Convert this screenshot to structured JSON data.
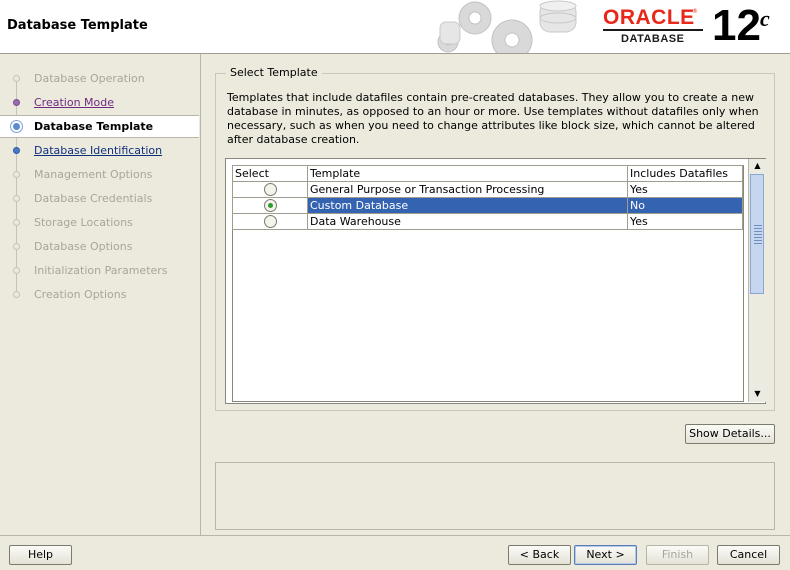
{
  "header": {
    "title": "Database Template",
    "logo_brand": "ORACLE",
    "logo_reg": "®",
    "logo_product": "DATABASE",
    "version_number": "12",
    "version_suffix": "c"
  },
  "sidebar": {
    "items": [
      {
        "label": "Database Operation",
        "state": "disabled"
      },
      {
        "label": "Creation Mode",
        "state": "done"
      },
      {
        "label": "Database Template",
        "state": "current"
      },
      {
        "label": "Database Identification",
        "state": "next"
      },
      {
        "label": "Management Options",
        "state": "disabled"
      },
      {
        "label": "Database Credentials",
        "state": "disabled"
      },
      {
        "label": "Storage Locations",
        "state": "disabled"
      },
      {
        "label": "Database Options",
        "state": "disabled"
      },
      {
        "label": "Initialization Parameters",
        "state": "disabled"
      },
      {
        "label": "Creation Options",
        "state": "disabled"
      }
    ]
  },
  "main": {
    "group_title": "Select Template",
    "description": "Templates that include datafiles contain pre-created databases. They allow you to create a new database in minutes, as opposed to an hour or more. Use templates without datafiles only when necessary, such as when you need to change attributes like block size, which cannot be altered after database creation.",
    "table": {
      "columns": [
        "Select",
        "Template",
        "Includes Datafiles"
      ],
      "rows": [
        {
          "selected": false,
          "template": "General Purpose or Transaction Processing",
          "datafiles": "Yes"
        },
        {
          "selected": true,
          "template": "Custom Database",
          "datafiles": "No"
        },
        {
          "selected": false,
          "template": "Data Warehouse",
          "datafiles": "Yes"
        }
      ]
    },
    "show_details_label": "Show Details..."
  },
  "footer": {
    "help_label": "Help",
    "back_label": "< Back",
    "next_label": "Next >",
    "finish_label": "Finish",
    "cancel_label": "Cancel"
  },
  "colors": {
    "selection": "#3363b1",
    "oracle_red": "#e8261a",
    "background": "#eceadd"
  }
}
